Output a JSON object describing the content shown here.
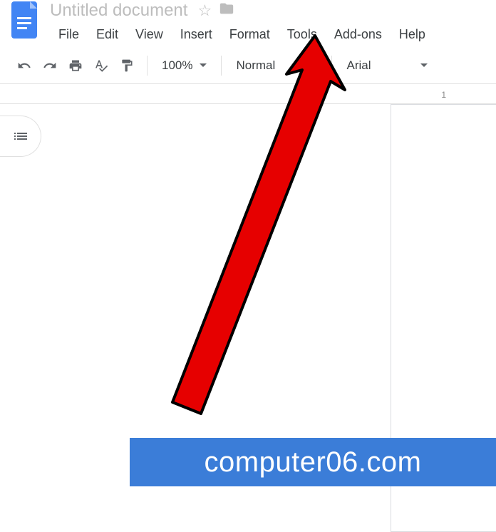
{
  "doc": {
    "title": "Untitled document"
  },
  "menu": {
    "file": "File",
    "edit": "Edit",
    "view": "View",
    "insert": "Insert",
    "format": "Format",
    "tools": "Tools",
    "addons": "Add-ons",
    "help": "Help"
  },
  "toolbar": {
    "zoom": "100%",
    "style": "Normal",
    "font": "Arial"
  },
  "ruler": {
    "mark1": "1"
  },
  "watermark": {
    "text": "computer06.com"
  }
}
